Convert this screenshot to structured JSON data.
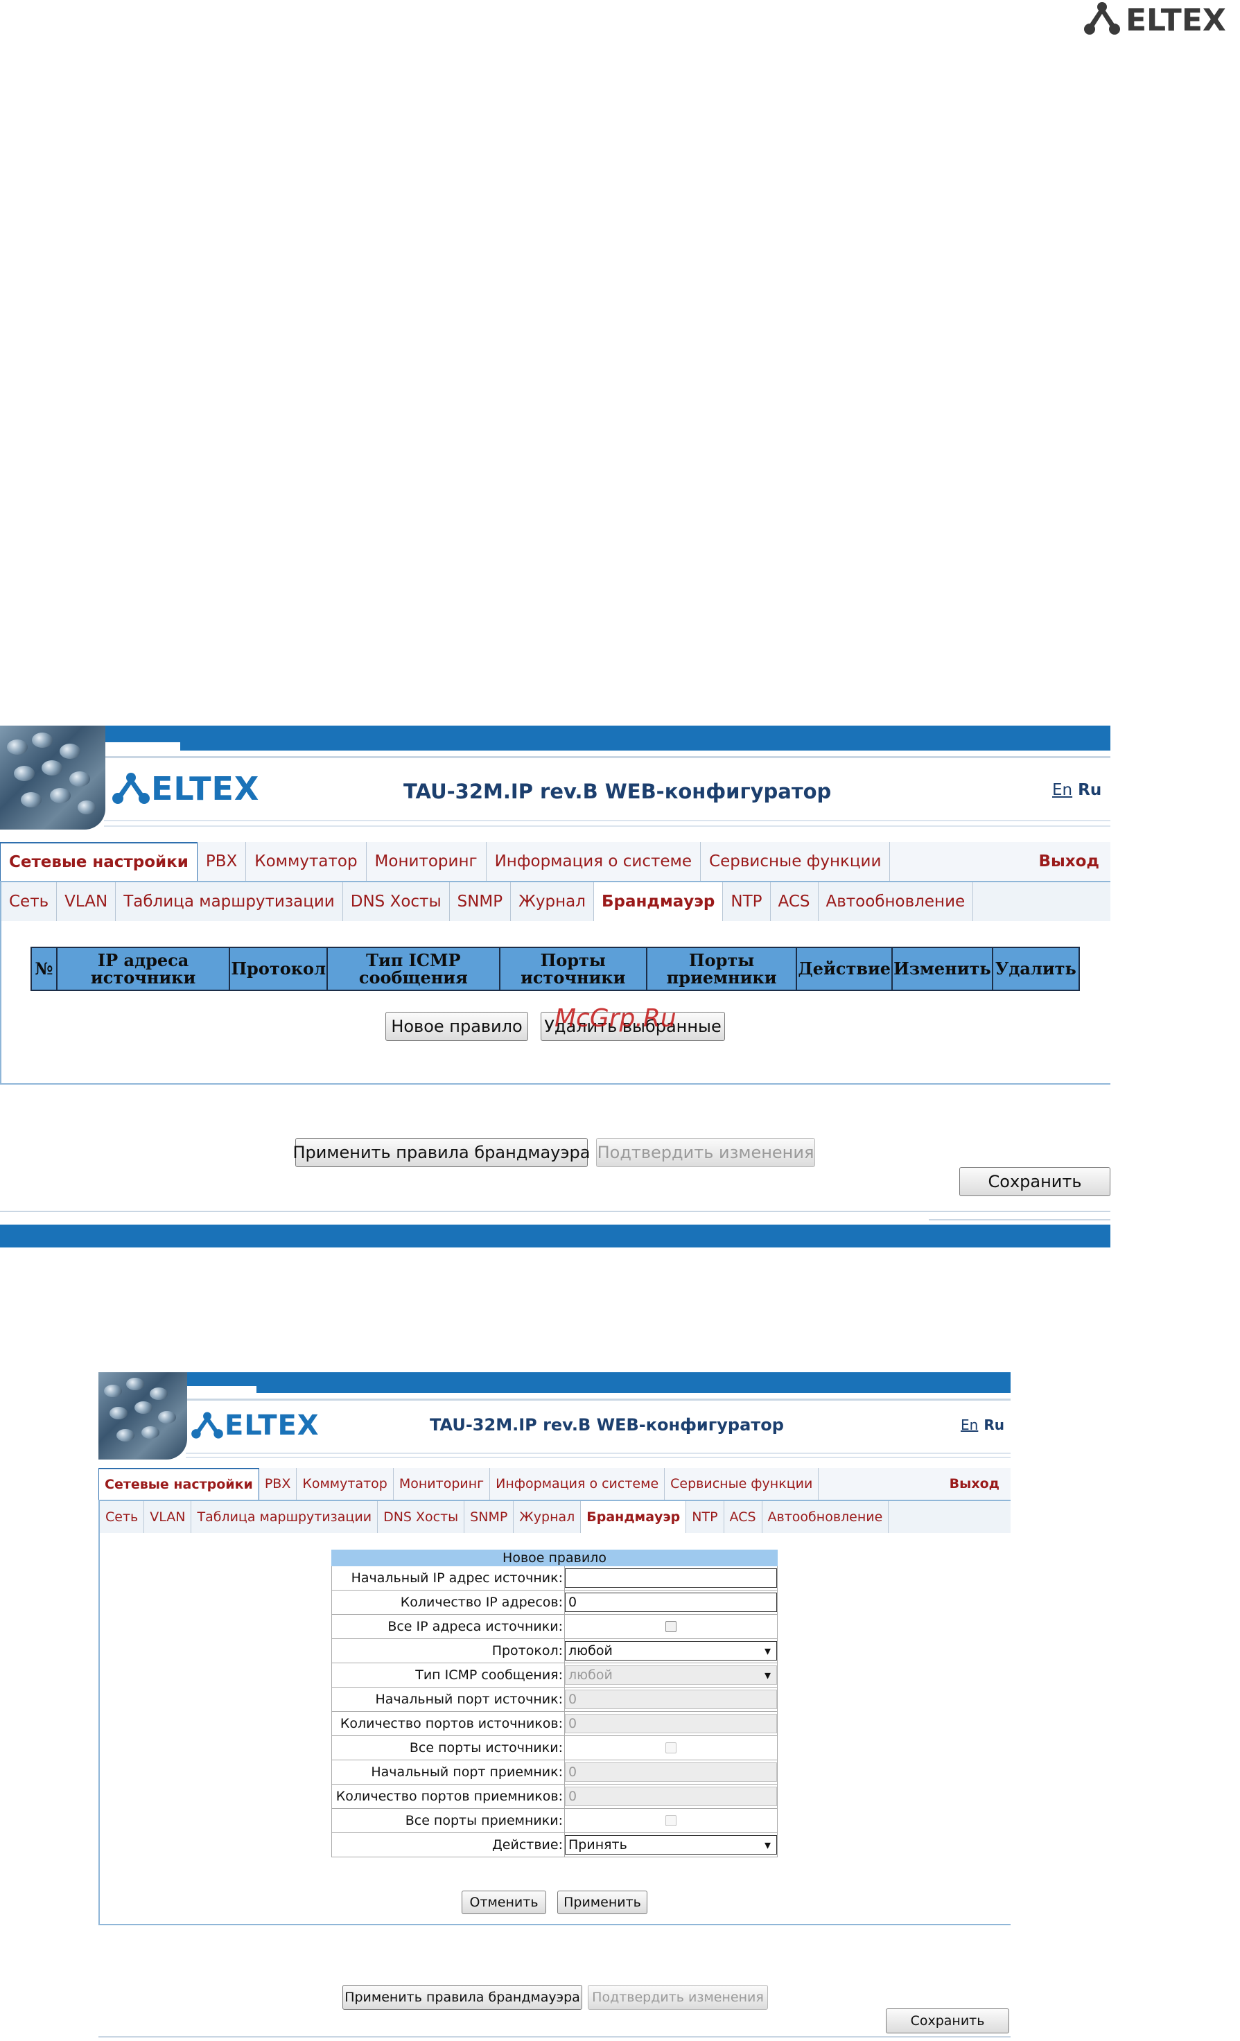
{
  "page_logo": {
    "text": "ELTEX"
  },
  "app": {
    "logo_text": "ELTEX",
    "title": "TAU-32M.IP rev.B WEB-конфигуратор",
    "lang_en": "En",
    "lang_ru": "Ru",
    "main_menu": [
      "Сетевые настройки",
      "PBX",
      "Коммутатор",
      "Мониторинг",
      "Информация о системе",
      "Сервисные функции"
    ],
    "logout": "Выход",
    "sub_menu": [
      "Сеть",
      "VLAN",
      "Таблица маршрутизации",
      "DNS Хосты",
      "SNMP",
      "Журнал",
      "Брандмауэр",
      "NTP",
      "ACS",
      "Автообновление"
    ],
    "active_main": "Сетевые настройки",
    "active_sub": "Брандмауэр",
    "apply_firewall": "Применить правила брандмауэра",
    "confirm_changes": "Подтвердить изменения",
    "save": "Сохранить"
  },
  "firewall": {
    "columns": [
      "№",
      "IP адреса источники",
      "Протокол",
      "Тип ICMP сообщения",
      "Порты источники",
      "Порты приемники",
      "Действие",
      "Изменить",
      "Удалить"
    ],
    "new_rule_button": "Новое правило",
    "delete_selected_button": "Удалить выбранные",
    "watermark": "McGrp.Ru"
  },
  "new_rule": {
    "caption": "Новое правило",
    "fields": [
      {
        "label": "Начальный IP адрес источник:",
        "type": "text",
        "value": "",
        "disabled": false
      },
      {
        "label": "Количество IP адресов:",
        "type": "text",
        "value": "0",
        "disabled": false
      },
      {
        "label": "Все IP адреса источники:",
        "type": "checkbox",
        "value": "",
        "disabled": false
      },
      {
        "label": "Протокол:",
        "type": "select",
        "value": "любой",
        "disabled": false
      },
      {
        "label": "Тип ICMP сообщения:",
        "type": "select",
        "value": "любой",
        "disabled": true
      },
      {
        "label": "Начальный порт источник:",
        "type": "text",
        "value": "0",
        "disabled": true
      },
      {
        "label": "Количество портов источников:",
        "type": "text",
        "value": "0",
        "disabled": true
      },
      {
        "label": "Все порты источники:",
        "type": "checkbox",
        "value": "",
        "disabled": true
      },
      {
        "label": "Начальный порт приемник:",
        "type": "text",
        "value": "0",
        "disabled": true
      },
      {
        "label": "Количество портов приемников:",
        "type": "text",
        "value": "0",
        "disabled": true
      },
      {
        "label": "Все порты приемники:",
        "type": "checkbox",
        "value": "",
        "disabled": true
      },
      {
        "label": "Действие:",
        "type": "select",
        "value": "Принять",
        "disabled": false
      }
    ],
    "cancel_button": "Отменить",
    "apply_button": "Применить"
  },
  "colors": {
    "brand_blue": "#1a72b8",
    "menu_red": "#9a1a1a",
    "table_header": "#5c9fd8",
    "caption_blue": "#9ec9ee"
  }
}
